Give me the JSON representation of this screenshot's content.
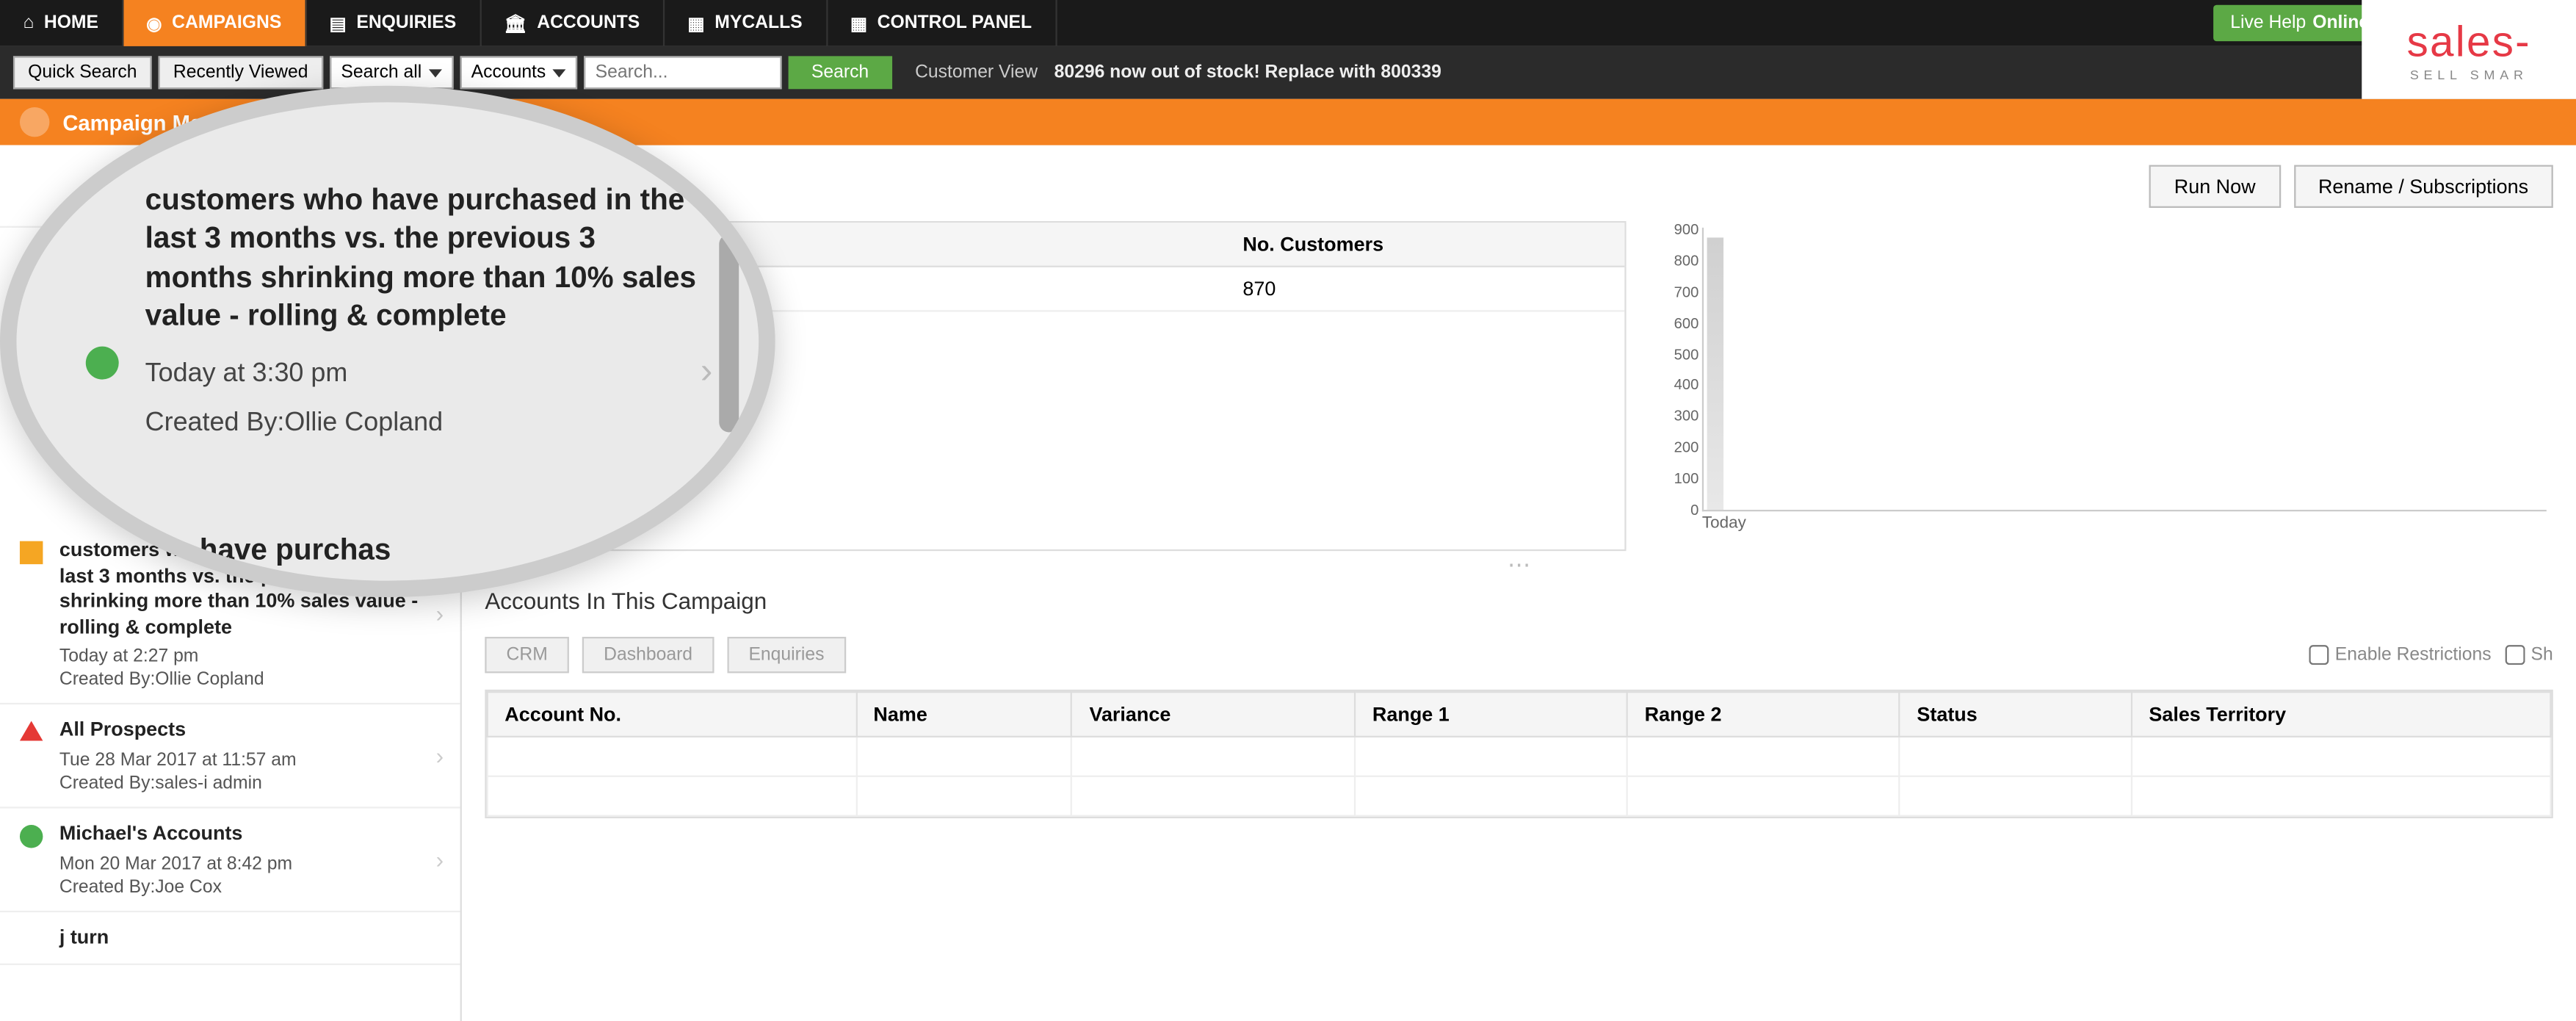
{
  "nav": {
    "home": "HOME",
    "campaigns": "CAMPAIGNS",
    "enquiries": "ENQUIRIES",
    "accounts": "ACCOUNTS",
    "mycalls": "MYCALLS",
    "control_panel": "CONTROL PANEL",
    "live_help": "Live Help",
    "online": "Online"
  },
  "secondbar": {
    "quick_search": "Quick Search",
    "recently_viewed": "Recently Viewed",
    "search_all": "Search all",
    "accounts": "Accounts",
    "search_placeholder": "Search...",
    "search_btn": "Search",
    "customer_view": "Customer View",
    "ticker": "80296 now out of stock! Replace with 800339"
  },
  "orangebar": {
    "title": "Campaign Manager"
  },
  "logo": {
    "main": "sales-",
    "sub": "SELL SMAR"
  },
  "buttons": {
    "run_now": "Run Now",
    "rename": "Rename / Subscriptions"
  },
  "sidebar": {
    "items": [
      {
        "title": "customers who have purchased in the last 3 months vs. the previous 3 months shrinking more than 10% sales value - rolling & complete",
        "meta": "Today at 2:27 pm",
        "creator": "Created By:Ollie Copland",
        "icon": "orange-sq"
      },
      {
        "title": "All Prospects",
        "meta": "Tue 28 Mar 2017 at 11:57 am",
        "creator": "Created By:sales-i admin",
        "icon": "red-tri"
      },
      {
        "title": "Michael's Accounts",
        "meta": "Mon 20 Mar 2017 at 8:42 pm",
        "creator": "Created By:Joe Cox",
        "icon": "green-dot"
      },
      {
        "title": "j turn",
        "meta": "",
        "creator": "",
        "icon": ""
      }
    ]
  },
  "magnifier": {
    "title": "customers who have purchased in the last 3 months vs. the previous 3 months shrinking more than 10% sales value - rolling & complete",
    "meta": "Today at 3:30 pm",
    "creator": "Created By:Ollie Copland",
    "partial": "who have purchas"
  },
  "table": {
    "header": "No. Customers",
    "value": "870"
  },
  "chart_data": {
    "type": "bar",
    "categories": [
      "Today"
    ],
    "values": [
      870
    ],
    "ylim": [
      0,
      900
    ],
    "yticks": [
      0,
      100,
      200,
      300,
      400,
      500,
      600,
      700,
      800,
      900
    ],
    "title": "",
    "xlabel": "",
    "ylabel": ""
  },
  "accounts": {
    "heading": "Accounts In This Campaign",
    "crm": "CRM",
    "dashboard": "Dashboard",
    "enquiries": "Enquiries",
    "enable_restrictions": "Enable Restrictions",
    "sh": "Sh",
    "columns": [
      "Account No.",
      "Name",
      "Variance",
      "Range 1",
      "Range 2",
      "Status",
      "Sales Territory"
    ]
  }
}
